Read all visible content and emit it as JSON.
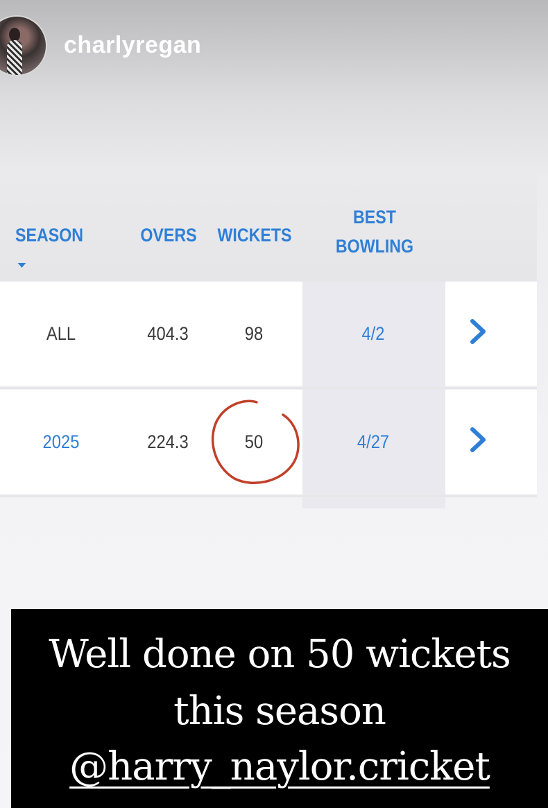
{
  "story": {
    "username": "charlyregan",
    "avatar_icon": "profile-avatar"
  },
  "table": {
    "headers": {
      "season": "SEASON",
      "overs": "OVERS",
      "wickets": "WICKETS",
      "best_line1": "BEST",
      "best_line2": "BOWLING"
    },
    "rows": [
      {
        "season": "ALL",
        "overs": "404.3",
        "wickets": "98",
        "best": "4/2"
      },
      {
        "season": "2025",
        "overs": "224.3",
        "wickets": "50",
        "best": "4/27"
      }
    ],
    "accent_color": "#2f7fd6",
    "circle_color": "#c0412a"
  },
  "caption": {
    "line1": "Well done on 50 wickets",
    "line2": "this season",
    "line3": "@harry_naylor.cricket"
  }
}
